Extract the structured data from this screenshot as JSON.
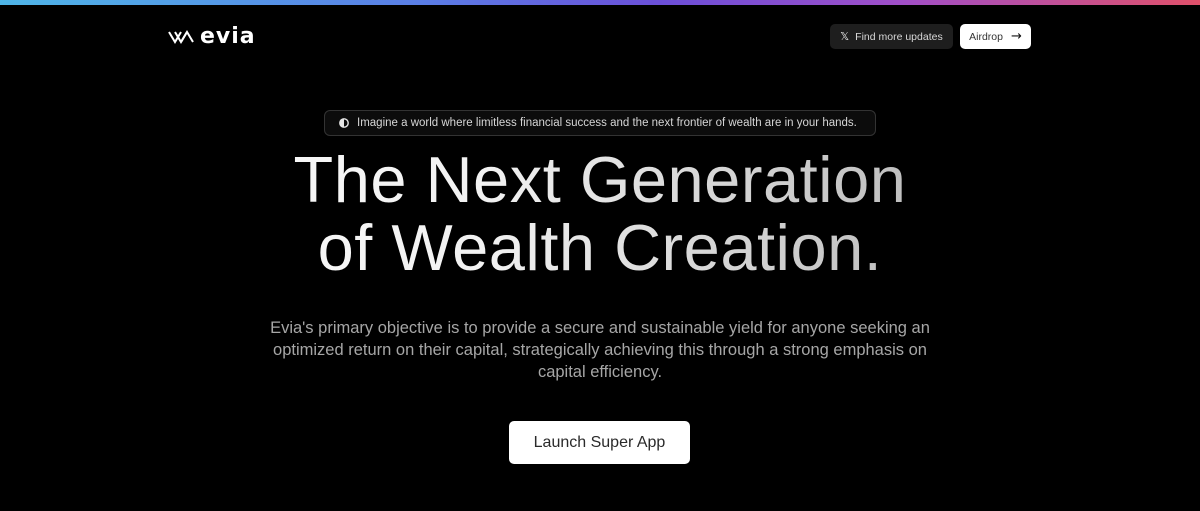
{
  "brand": {
    "name": "evia",
    "logo_icon": "evia-chevron-mark-icon"
  },
  "colors": {
    "background": "#000000",
    "top_bar_gradient": [
      "#4fb6e8",
      "#6b4fd8",
      "#e0506a"
    ],
    "primary_button_bg": "#ffffff",
    "secondary_button_bg": "#1e1e1e"
  },
  "header": {
    "updates_button": {
      "icon": "x-logo-icon",
      "label": "Find more updates"
    },
    "airdrop_button": {
      "label": "Airdrop",
      "icon": "arrow-right-icon"
    }
  },
  "hero": {
    "announcement": {
      "icon": "half-circle-icon",
      "text": "Imagine a world where limitless financial success and the next frontier of wealth are in your hands."
    },
    "headline_line1": "The Next Generation",
    "headline_line2": "of Wealth Creation.",
    "description": "Evia's primary objective is to provide a secure and sustainable yield for anyone seeking an optimized return on their capital, strategically achieving this through a strong emphasis on capital efficiency.",
    "cta_label": "Launch Super App"
  }
}
